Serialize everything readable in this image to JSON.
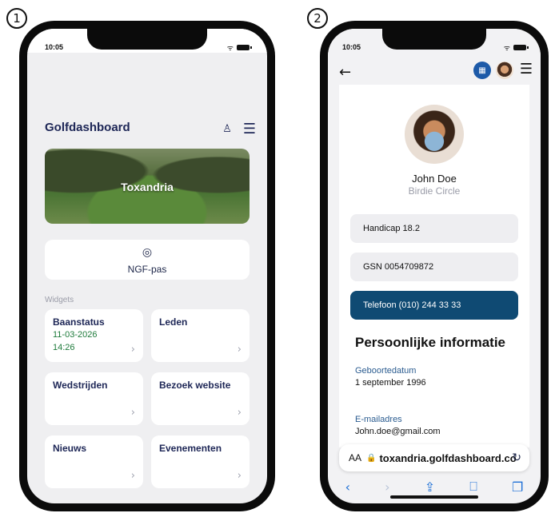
{
  "badges": {
    "one": "1",
    "two": "2"
  },
  "phone1": {
    "status": {
      "time": "10:05"
    },
    "header": {
      "title": "Golfdashboard",
      "user_icon": "user-icon",
      "menu_icon": "hamburger-icon"
    },
    "hero": {
      "label": "Toxandria"
    },
    "ngf": {
      "icon": "profile-circle-icon",
      "label": "NGF-pas"
    },
    "widgets_label": "Widgets",
    "widgets": [
      {
        "title": "Baanstatus",
        "line1": "11-03-2026",
        "line2": "14:26"
      },
      {
        "title": "Leden",
        "line1": "",
        "line2": ""
      },
      {
        "title": "Wedstrijden",
        "line1": "",
        "line2": ""
      },
      {
        "title": "Bezoek website",
        "line1": "",
        "line2": ""
      },
      {
        "title": "Nieuws",
        "line1": "",
        "line2": ""
      },
      {
        "title": "Evenementen",
        "line1": "",
        "line2": ""
      }
    ]
  },
  "phone2": {
    "status": {
      "time": "10:05"
    },
    "profile": {
      "name": "John Doe",
      "club": "Birdie Circle"
    },
    "fields": {
      "handicap": "Handicap 18.2",
      "gsn": "GSN 0054709872",
      "phone": "Telefoon (010) 244 33 33"
    },
    "section_title": "Persoonlijke informatie",
    "birth": {
      "label": "Geboortedatum",
      "value": "1 september 1996"
    },
    "email": {
      "label": "E-mailadres",
      "value": "John.doe@gmail.com"
    },
    "browser": {
      "aa": "AA",
      "url": "toxandria.golfdashboard.co"
    }
  },
  "colors": {
    "navy": "#1d2656",
    "green": "#1d7a3a",
    "blue_button": "#0f4a73",
    "ios_blue": "#1d6fd6"
  }
}
